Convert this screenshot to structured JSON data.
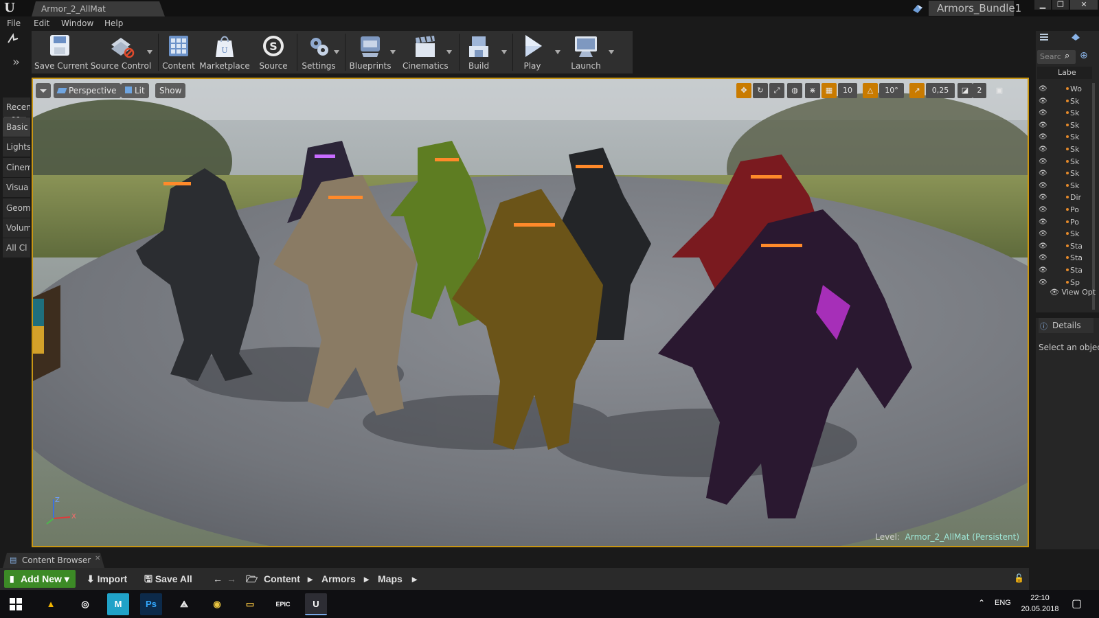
{
  "window": {
    "tab_title": "Armor_2_AllMat",
    "project_name": "Armors_Bundle1"
  },
  "menu": [
    "File",
    "Edit",
    "Window",
    "Help"
  ],
  "place_categories": [
    "Recen",
    "Basic",
    "Lights",
    "Cinem",
    "Visua",
    "Geom",
    "Volum",
    "All Cl"
  ],
  "toolbar": {
    "save_current": "Save Current",
    "source_control": "Source Control",
    "content": "Content",
    "marketplace": "Marketplace",
    "source": "Source",
    "settings": "Settings",
    "blueprints": "Blueprints",
    "cinematics": "Cinematics",
    "build": "Build",
    "play": "Play",
    "launch": "Launch"
  },
  "viewport": {
    "perspective": "Perspective",
    "lit": "Lit",
    "show": "Show",
    "grid_snap": "10",
    "rotation_snap": "10°",
    "scale_snap": "0,25",
    "camera_speed": "2",
    "level_label": "Level:",
    "level_name": "Armor_2_AllMat (Persistent)",
    "axis_z": "Z",
    "axis_x": "X"
  },
  "outliner": {
    "search_placeholder": "Searc",
    "column_label": "Labe",
    "rows": [
      "Wo",
      "Sk",
      "Sk",
      "Sk",
      "Sk",
      "Sk",
      "Sk",
      "Sk",
      "Sk",
      "Dir",
      "Po",
      "Po",
      "Sk",
      "Sta",
      "Sta",
      "Sta",
      "Sp"
    ],
    "view_options": "View Opt"
  },
  "details": {
    "tab": "Details",
    "empty_text": "Select an object"
  },
  "content_browser": {
    "tab": "Content Browser",
    "add_new": "Add New",
    "import": "Import",
    "save_all": "Save All",
    "path": [
      "Content",
      "Armors",
      "Maps"
    ]
  },
  "taskbar": {
    "language": "ENG",
    "time": "22:10",
    "date": "20.05.2018"
  },
  "colors": {
    "viewport_border": "#c89614",
    "add_new_green": "#3c8a26",
    "level_name": "#9fe8d8"
  }
}
